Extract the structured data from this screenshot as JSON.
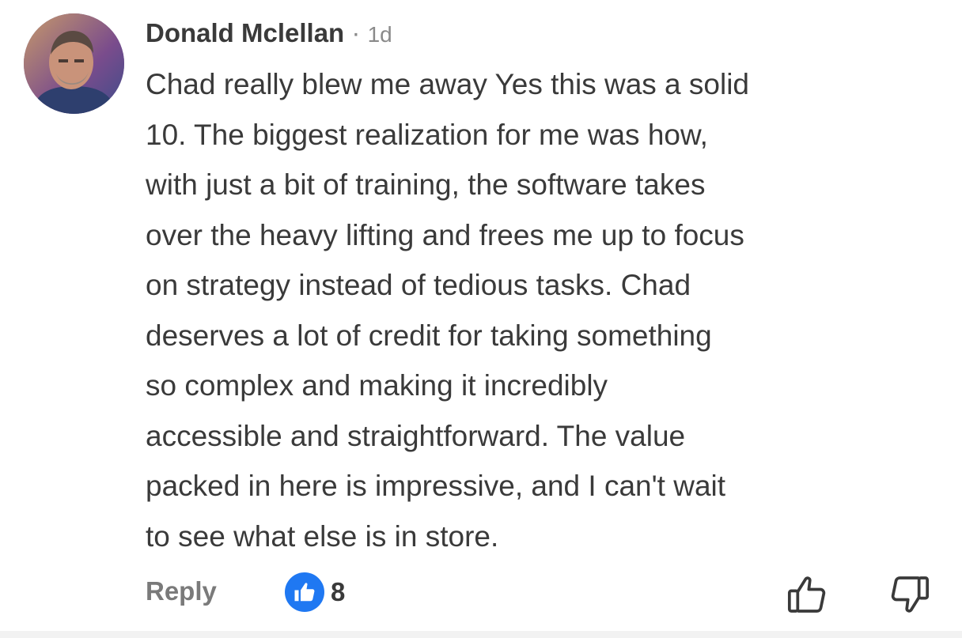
{
  "comment": {
    "author": "Donald Mclellan",
    "separator": "·",
    "time": "1d",
    "body_lines": [
      "Chad really blew me away Yes this was a solid",
      "10. The biggest realization for me was how,",
      "with just a bit of training, the software takes",
      "over the heavy lifting and frees me up to focus",
      "on strategy instead of tedious tasks. Chad",
      "deserves a lot of credit for taking something",
      "so complex and making it incredibly",
      "accessible and straightforward. The value",
      "packed in here is impressive, and I can't wait",
      "to see what else is in store."
    ],
    "reply_label": "Reply",
    "like_count": "8"
  },
  "icons": {
    "like_badge": "thumbs-up-icon",
    "upvote": "thumb-up-outline-icon",
    "downvote": "thumb-down-outline-icon"
  },
  "colors": {
    "like_badge": "#1f78f2",
    "text": "#3a3a3a",
    "muted": "#7a7a7a"
  }
}
